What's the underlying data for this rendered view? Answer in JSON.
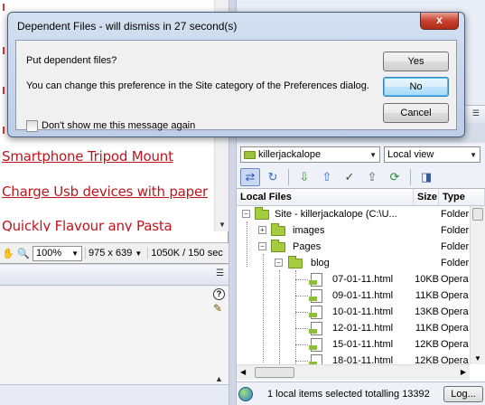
{
  "dialog": {
    "title": "Dependent Files - will dismiss in 27 second(s)",
    "close_label": "x",
    "question": "Put dependent files?",
    "info": "You can change this preference in the Site category of the Preferences dialog.",
    "checkbox_label": "Don't show me this message again",
    "checkbox_checked": false,
    "yes_label": "Yes",
    "no_label": "No",
    "cancel_label": "Cancel"
  },
  "design_view": {
    "links": [
      "Smartphone Tripod Mount",
      "Charge Usb devices with paper",
      "Quickly Flavour any Pasta"
    ],
    "link_color": "#c0141c"
  },
  "statusbar": {
    "zoom": "100%",
    "window_size": "975 x 639",
    "download": "1050K / 150 sec"
  },
  "files_panel": {
    "site_select": "killerjackalope",
    "view_select": "Local view",
    "columns": {
      "name": "Local Files",
      "size": "Size",
      "type": "Type"
    },
    "rows": [
      {
        "name": "Site - killerjackalope (C:\\U...",
        "size": "",
        "type": "Folder",
        "kind": "site"
      },
      {
        "name": "images",
        "size": "",
        "type": "Folder",
        "kind": "folder"
      },
      {
        "name": "Pages",
        "size": "",
        "type": "Folder",
        "kind": "folder"
      },
      {
        "name": "blog",
        "size": "",
        "type": "Folder",
        "kind": "folder"
      },
      {
        "name": "07-01-11.html",
        "size": "10KB",
        "type": "Opera",
        "kind": "file"
      },
      {
        "name": "09-01-11.html",
        "size": "11KB",
        "type": "Opera",
        "kind": "file"
      },
      {
        "name": "10-01-11.html",
        "size": "13KB",
        "type": "Opera",
        "kind": "file"
      },
      {
        "name": "12-01-11.html",
        "size": "11KB",
        "type": "Opera",
        "kind": "file"
      },
      {
        "name": "15-01-11.html",
        "size": "12KB",
        "type": "Opera",
        "kind": "file"
      },
      {
        "name": "18-01-11.html",
        "size": "12KB",
        "type": "Opera",
        "kind": "file"
      }
    ],
    "status_text": "1 local items selected totalling 13392",
    "log_label": "Log..."
  }
}
